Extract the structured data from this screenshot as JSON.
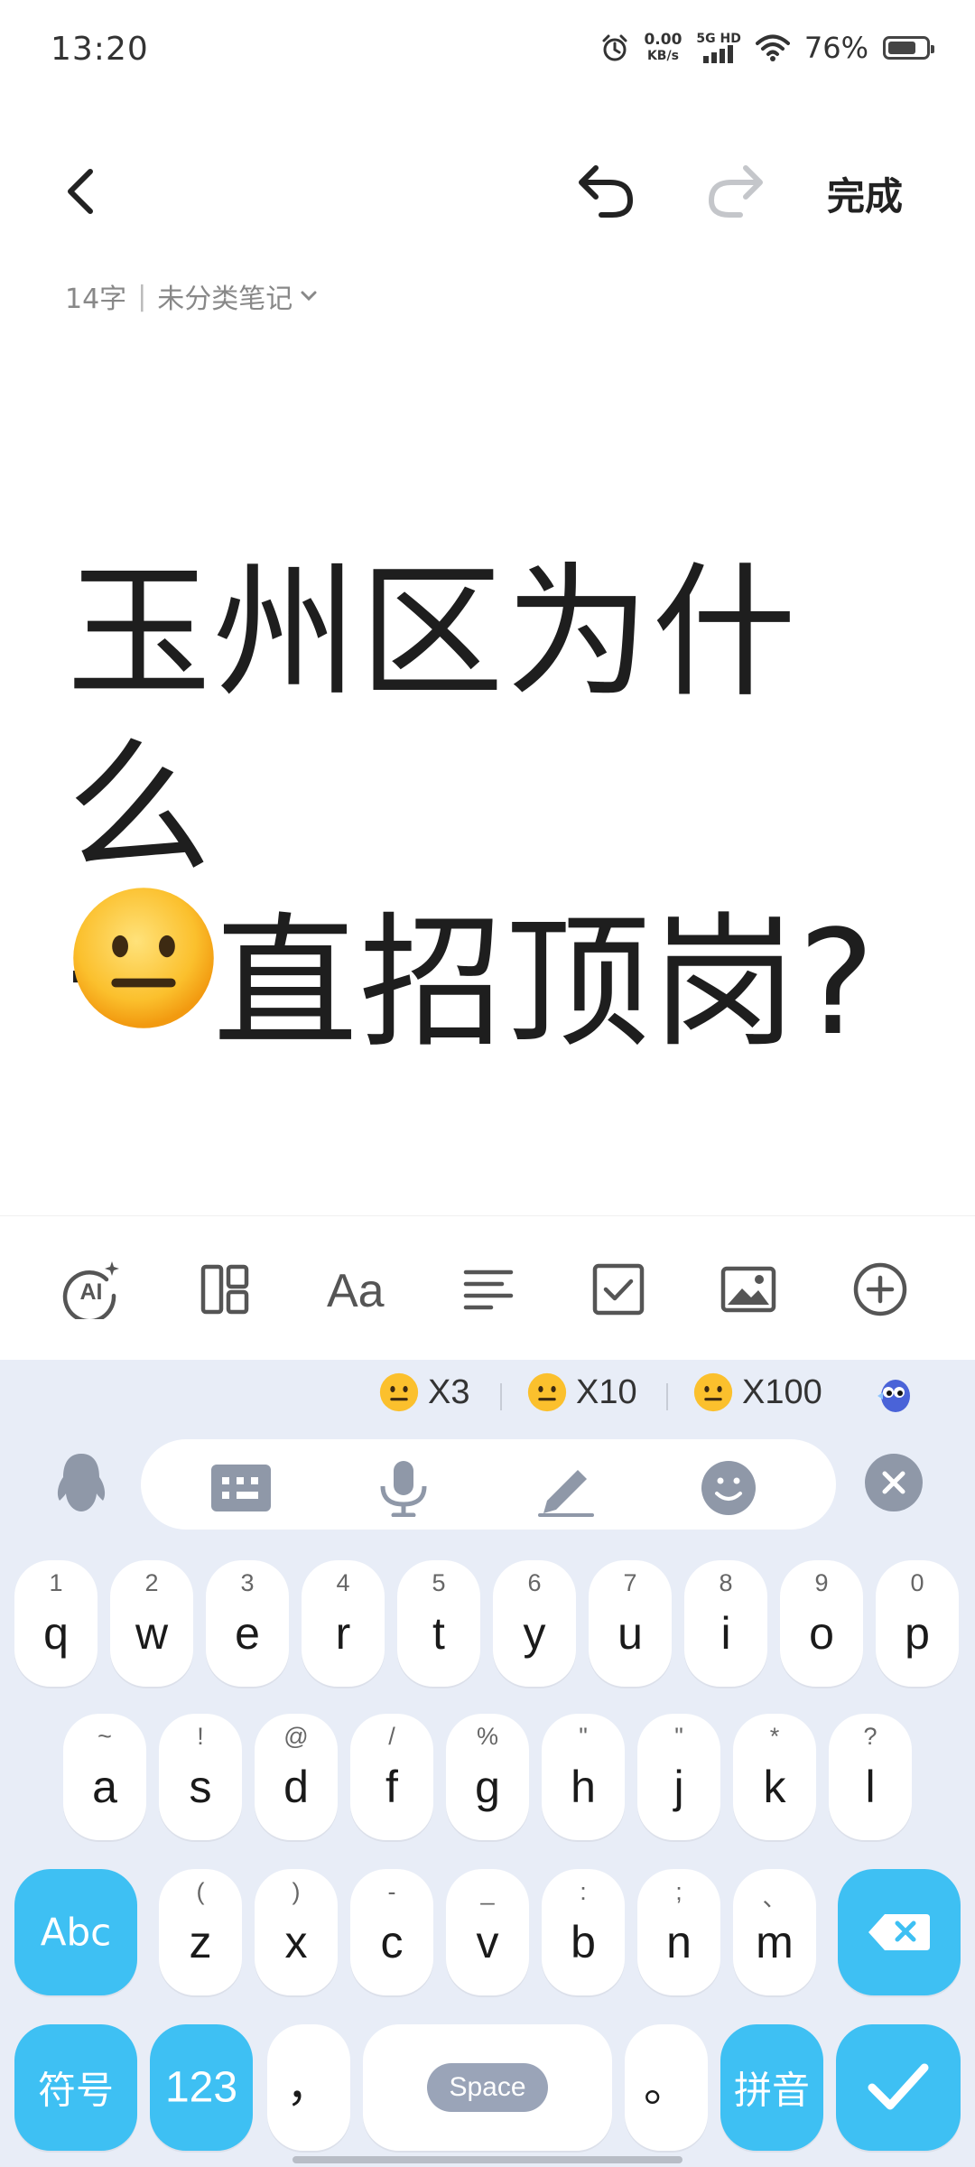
{
  "status_bar": {
    "time": "13:20",
    "net_speed": "0.00",
    "net_unit": "KB/s",
    "network": "5G HD",
    "battery_pct": "76%",
    "battery_level": 0.76
  },
  "toolbar": {
    "done_label": "完成"
  },
  "note": {
    "word_count": "14字",
    "category": "未分类笔记",
    "title_line1": "玉州区为什么",
    "title_line2": "一直招顶岗?"
  },
  "icons": {
    "back": "back-arrow-icon",
    "undo": "undo-icon",
    "redo": "redo-icon",
    "emoji": "neutral-face-emoji",
    "fmt": [
      "ai-icon",
      "layout-icon",
      "font-icon",
      "align-icon",
      "checkbox-icon",
      "image-icon",
      "add-icon"
    ],
    "keyboard_tools": [
      "penguin-icon",
      "keyboard-icon",
      "mic-icon",
      "pen-icon",
      "smile-icon",
      "close-icon"
    ]
  },
  "keyboard": {
    "suggestions": [
      "X3",
      "X10",
      "X100"
    ],
    "row1": [
      {
        "k": "q",
        "h": "1"
      },
      {
        "k": "w",
        "h": "2"
      },
      {
        "k": "e",
        "h": "3"
      },
      {
        "k": "r",
        "h": "4"
      },
      {
        "k": "t",
        "h": "5"
      },
      {
        "k": "y",
        "h": "6"
      },
      {
        "k": "u",
        "h": "7"
      },
      {
        "k": "i",
        "h": "8"
      },
      {
        "k": "o",
        "h": "9"
      },
      {
        "k": "p",
        "h": "0"
      }
    ],
    "row2": [
      {
        "k": "a",
        "h": "~"
      },
      {
        "k": "s",
        "h": "!"
      },
      {
        "k": "d",
        "h": "@"
      },
      {
        "k": "f",
        "h": "/"
      },
      {
        "k": "g",
        "h": "%"
      },
      {
        "k": "h",
        "h": "\""
      },
      {
        "k": "j",
        "h": "\""
      },
      {
        "k": "k",
        "h": "*"
      },
      {
        "k": "l",
        "h": "?"
      }
    ],
    "row3": [
      {
        "k": "z",
        "h": "("
      },
      {
        "k": "x",
        "h": ")"
      },
      {
        "k": "c",
        "h": "-"
      },
      {
        "k": "v",
        "h": "_"
      },
      {
        "k": "b",
        "h": ":"
      },
      {
        "k": "n",
        "h": ";"
      },
      {
        "k": "m",
        "h": "、"
      }
    ],
    "abc_label": "Abc",
    "symbol_label": "符号",
    "num_label": "123",
    "comma_label": "，",
    "space_label": "Space",
    "period_label": "。",
    "pinyin_label": "拼音"
  }
}
